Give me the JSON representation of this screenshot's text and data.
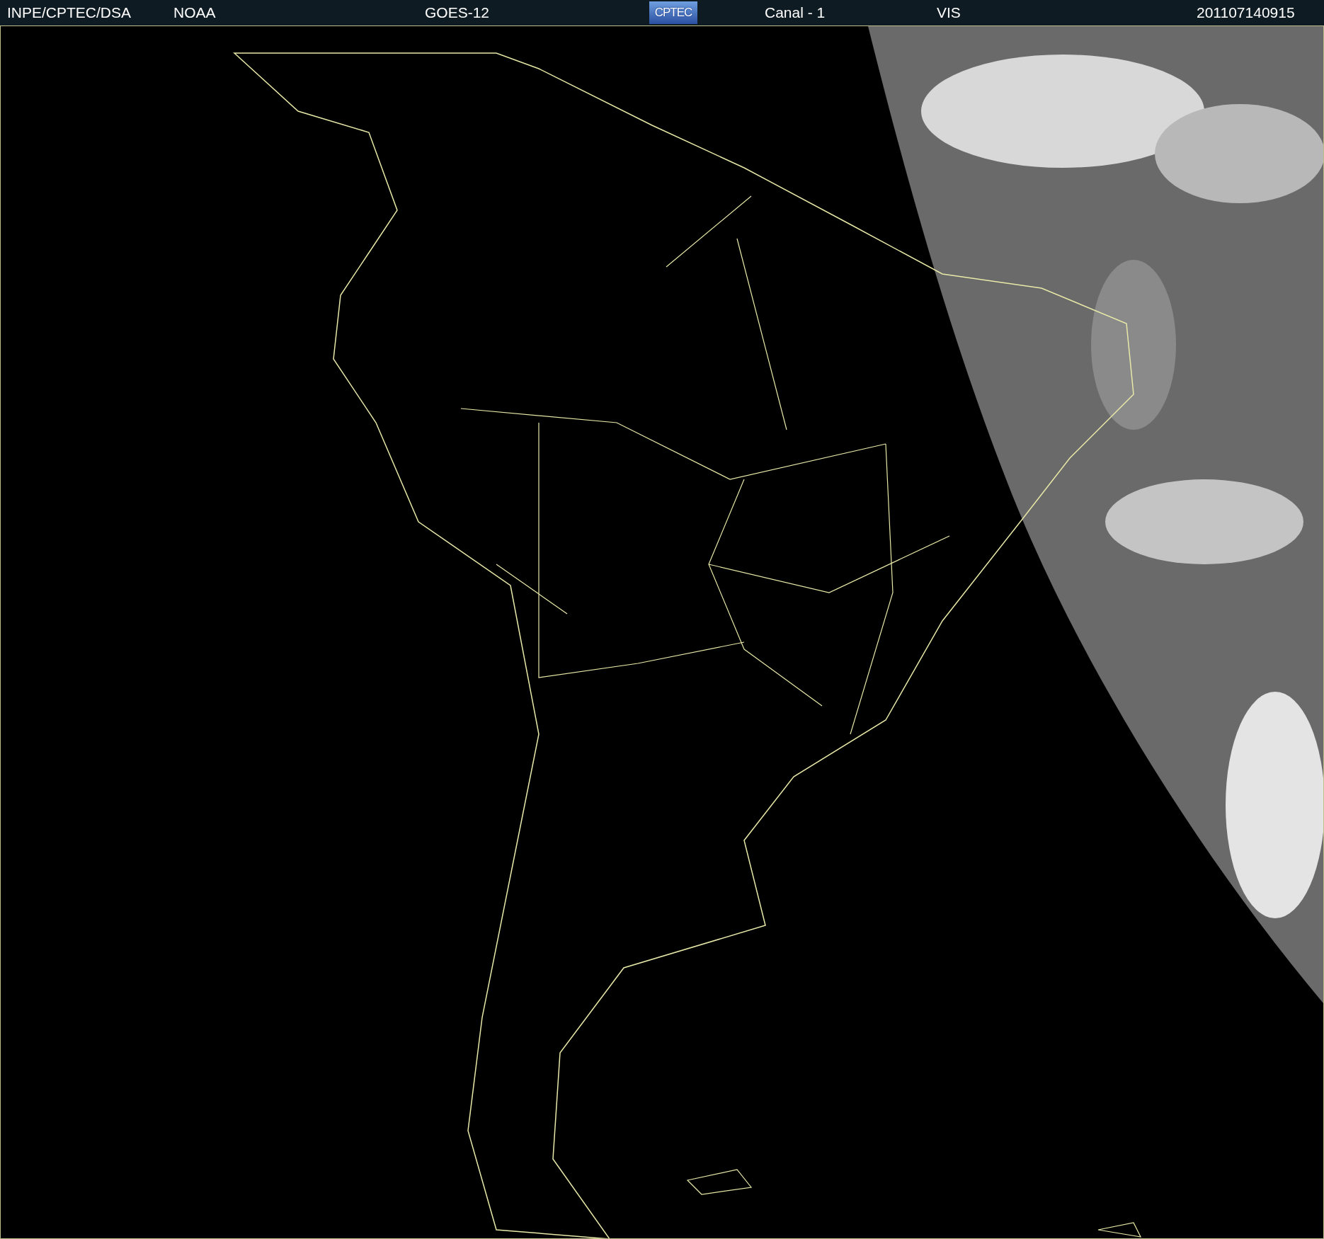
{
  "header": {
    "source": "INPE/CPTEC/DSA",
    "agency": "NOAA",
    "satellite": "GOES-12",
    "logo": "CPTEC",
    "channel": "Canal - 1",
    "band": "VIS",
    "timestamp": "201107140915"
  }
}
